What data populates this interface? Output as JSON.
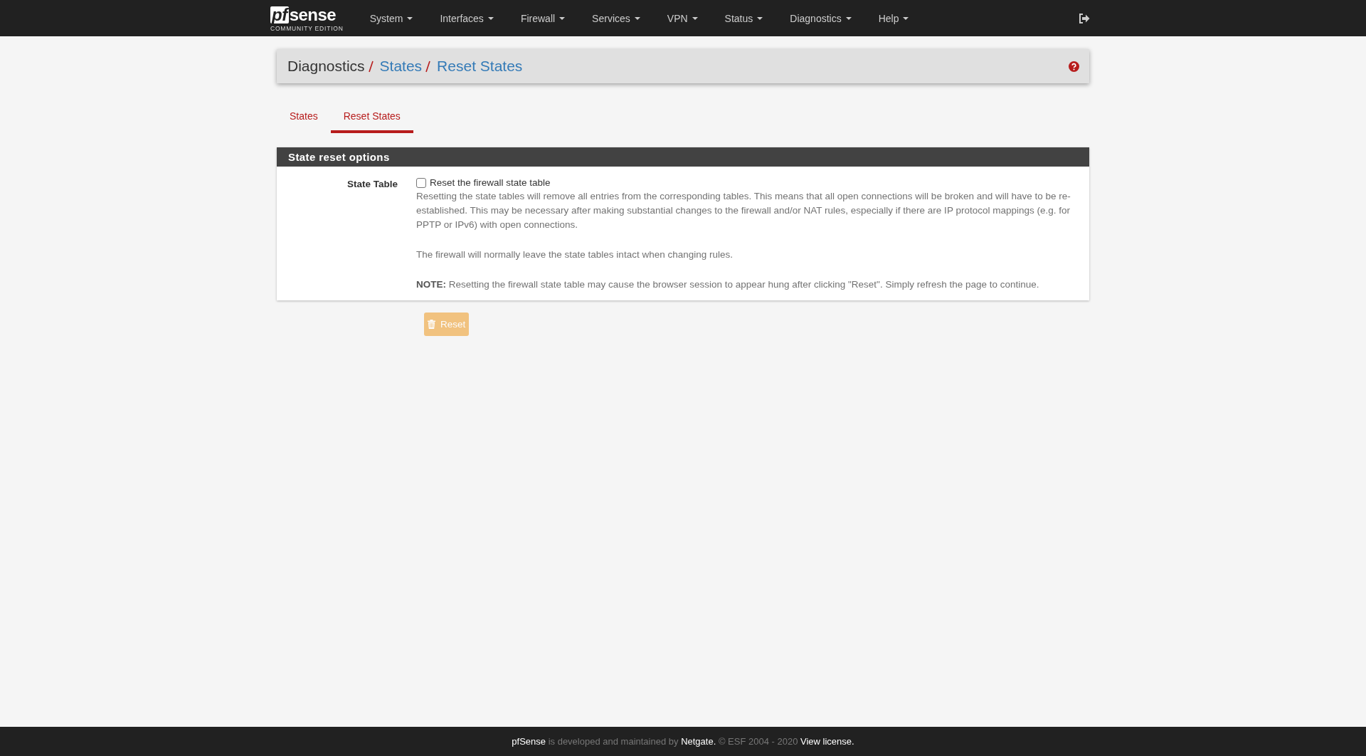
{
  "navbar": {
    "logo": {
      "mark": "pf",
      "word": "sense",
      "edition": "COMMUNITY EDITION"
    },
    "menus": [
      {
        "label": "System"
      },
      {
        "label": "Interfaces"
      },
      {
        "label": "Firewall"
      },
      {
        "label": "Services"
      },
      {
        "label": "VPN"
      },
      {
        "label": "Status"
      },
      {
        "label": "Diagnostics"
      },
      {
        "label": "Help"
      }
    ]
  },
  "breadcrumb": [
    {
      "label": "Diagnostics",
      "link": false
    },
    {
      "label": "States",
      "link": true
    },
    {
      "label": "Reset States",
      "link": true
    }
  ],
  "tabs": [
    {
      "label": "States",
      "selected": false
    },
    {
      "label": "Reset States",
      "selected": true
    }
  ],
  "panel": {
    "title": "State reset options",
    "fields": [
      {
        "label": "State Table",
        "checkbox": {
          "label": "Reset the firewall state table",
          "checked": false
        },
        "help": [
          "Resetting the state tables will remove all entries from the corresponding tables. This means that all open connections will be broken and will have to be re-established. This may be necessary after making substantial changes to the firewall and/or NAT rules, especially if there are IP protocol mappings (e.g. for PPTP or IPv6) with open connections.",
          "The firewall will normally leave the state tables intact when changing rules.",
          "**NOTE:** Resetting the firewall state table may cause the browser session to appear hung after clicking \"Reset\". Simply refresh the page to continue."
        ]
      }
    ]
  },
  "buttons": [
    {
      "label": "Reset",
      "disabled": true
    }
  ],
  "footer": [
    {
      "text": "pfSense",
      "kind": "brand"
    },
    {
      "text": "is developed and maintained by",
      "kind": "plain"
    },
    {
      "text": "Netgate.",
      "kind": "link"
    },
    {
      "text": "© ESF 2004 - 2020",
      "kind": "plain"
    },
    {
      "text": "View license.",
      "kind": "link"
    }
  ]
}
